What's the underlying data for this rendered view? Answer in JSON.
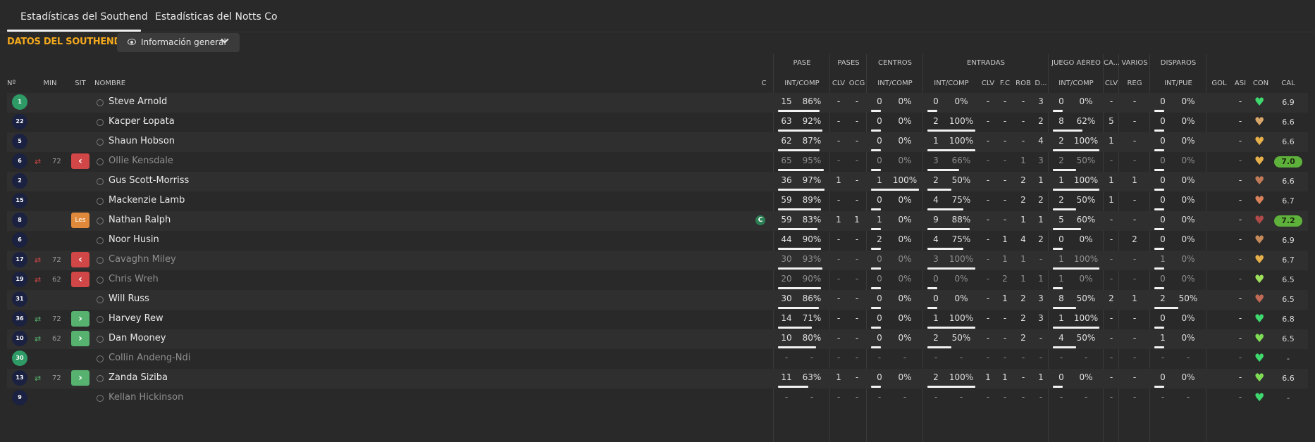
{
  "tabs": [
    "Estadísticas del Southend",
    "Estadísticas del Notts Co"
  ],
  "section_title": "DATOS DEL SOUTHEND",
  "view_select": "Información general",
  "col_headers": {
    "no": "Nº",
    "min": "MIN",
    "sit": "SIT",
    "nombre": "NOMBRE",
    "c": "C",
    "pase_ic": "INT/COMP",
    "clv": "CLV",
    "ocg": "OCG",
    "centros_ic": "INT/COMP",
    "entradas_ic": "INT/COMP",
    "ent_clv": "CLV",
    "fc": "F.C",
    "rob": "ROB",
    "d": "D...",
    "aereo_ic": "INT/COMP",
    "ca_clv": "CLV",
    "reg": "REG",
    "int_pue": "INT/PUE",
    "gol": "GOL",
    "asi": "ASI",
    "con": "CON",
    "cal": "CAL"
  },
  "group_headers": {
    "pase": "PASE",
    "pases": "PASES",
    "centros": "CENTROS",
    "entradas": "ENTRADAS",
    "juego_aereo": "JUEGO AÉREO",
    "ca": "CA...",
    "varios": "VARIOS",
    "disparos": "DISPAROS"
  },
  "colors": {
    "accent": "#f2a81d",
    "sub_off": "#d14646",
    "sub_on": "#56b26e",
    "les": "#e0893a",
    "high_rating": "#5eb13a"
  },
  "rows": [
    {
      "no": "1",
      "gk": true,
      "sub": "",
      "min": "",
      "sit": "",
      "name": "Steve Arnold",
      "dim": false,
      "cap": false,
      "pase": [
        "15",
        "86%"
      ],
      "clv": "-",
      "ocg": "-",
      "cen": [
        "0",
        "0%"
      ],
      "ent": [
        "0",
        "0%"
      ],
      "eclv": "-",
      "fc": "-",
      "rob": "-",
      "d": "3",
      "aer": [
        "0",
        "0%"
      ],
      "caclv": "-",
      "reg": "-",
      "disp": [
        "0",
        "0%"
      ],
      "gol": "",
      "asi": "-",
      "heart": "#3ed86f",
      "cal": "6.9",
      "hi": false,
      "fill": {
        "pase": 0.87,
        "cen": 0,
        "ent": 0,
        "aer": 0,
        "disp": 0
      }
    },
    {
      "no": "22",
      "gk": false,
      "sub": "",
      "min": "",
      "sit": "",
      "name": "Kacper Łopata",
      "dim": false,
      "cap": false,
      "pase": [
        "63",
        "92%"
      ],
      "clv": "-",
      "ocg": "-",
      "cen": [
        "0",
        "0%"
      ],
      "ent": [
        "2",
        "100%"
      ],
      "eclv": "-",
      "fc": "-",
      "rob": "-",
      "d": "2",
      "aer": [
        "8",
        "62%"
      ],
      "caclv": "5",
      "reg": "-",
      "disp": [
        "0",
        "0%"
      ],
      "gol": "",
      "asi": "-",
      "heart": "#d9a66a",
      "cal": "6.6",
      "hi": false,
      "fill": {
        "pase": 0.93,
        "cen": 0,
        "ent": 1,
        "aer": 0.63,
        "disp": 0
      }
    },
    {
      "no": "5",
      "gk": false,
      "sub": "",
      "min": "",
      "sit": "",
      "name": "Shaun Hobson",
      "dim": false,
      "cap": false,
      "pase": [
        "62",
        "87%"
      ],
      "clv": "-",
      "ocg": "-",
      "cen": [
        "0",
        "0%"
      ],
      "ent": [
        "1",
        "100%"
      ],
      "eclv": "-",
      "fc": "-",
      "rob": "-",
      "d": "4",
      "aer": [
        "2",
        "100%"
      ],
      "caclv": "1",
      "reg": "-",
      "disp": [
        "0",
        "0%"
      ],
      "gol": "",
      "asi": "-",
      "heart": "#e8b04a",
      "cal": "6.6",
      "hi": false,
      "fill": {
        "pase": 0.87,
        "cen": 0,
        "ent": 1,
        "aer": 1,
        "disp": 0
      }
    },
    {
      "no": "6",
      "gk": false,
      "sub": "off",
      "min": "72",
      "sit": "off",
      "name": "Ollie Kensdale",
      "dim": true,
      "cap": false,
      "pase": [
        "65",
        "95%"
      ],
      "clv": "-",
      "ocg": "-",
      "cen": [
        "0",
        "0%"
      ],
      "ent": [
        "3",
        "66%"
      ],
      "eclv": "-",
      "fc": "-",
      "rob": "1",
      "d": "3",
      "aer": [
        "2",
        "50%"
      ],
      "caclv": "-",
      "reg": "-",
      "disp": [
        "0",
        "0%"
      ],
      "gol": "",
      "asi": "-",
      "heart": "#e8b04a",
      "cal": "7.0",
      "hi": true,
      "fill": {
        "pase": 0.95,
        "cen": 0,
        "ent": 0.66,
        "aer": 0.5,
        "disp": 0
      }
    },
    {
      "no": "2",
      "gk": false,
      "sub": "",
      "min": "",
      "sit": "",
      "name": "Gus Scott-Morriss",
      "dim": false,
      "cap": false,
      "pase": [
        "36",
        "97%"
      ],
      "clv": "1",
      "ocg": "-",
      "cen": [
        "1",
        "100%"
      ],
      "ent": [
        "2",
        "50%"
      ],
      "eclv": "-",
      "fc": "-",
      "rob": "2",
      "d": "1",
      "aer": [
        "1",
        "100%"
      ],
      "caclv": "1",
      "reg": "1",
      "disp": [
        "0",
        "0%"
      ],
      "gol": "",
      "asi": "-",
      "heart": "#c07a56",
      "cal": "6.6",
      "hi": false,
      "fill": {
        "pase": 0.97,
        "cen": 1,
        "ent": 0.5,
        "aer": 1,
        "disp": 0
      }
    },
    {
      "no": "15",
      "gk": false,
      "sub": "",
      "min": "",
      "sit": "",
      "name": "Mackenzie Lamb",
      "dim": false,
      "cap": false,
      "pase": [
        "59",
        "89%"
      ],
      "clv": "-",
      "ocg": "-",
      "cen": [
        "0",
        "0%"
      ],
      "ent": [
        "4",
        "75%"
      ],
      "eclv": "-",
      "fc": "-",
      "rob": "2",
      "d": "2",
      "aer": [
        "2",
        "50%"
      ],
      "caclv": "1",
      "reg": "-",
      "disp": [
        "0",
        "0%"
      ],
      "gol": "",
      "asi": "-",
      "heart": "#d9825a",
      "cal": "6.7",
      "hi": false,
      "fill": {
        "pase": 0.89,
        "cen": 0,
        "ent": 0.75,
        "aer": 0.5,
        "disp": 0
      }
    },
    {
      "no": "8",
      "gk": false,
      "sub": "",
      "min": "",
      "sit": "les",
      "name": "Nathan Ralph",
      "dim": false,
      "cap": true,
      "pase": [
        "59",
        "83%"
      ],
      "clv": "1",
      "ocg": "1",
      "cen": [
        "1",
        "0%"
      ],
      "ent": [
        "9",
        "88%"
      ],
      "eclv": "-",
      "fc": "-",
      "rob": "1",
      "d": "1",
      "aer": [
        "5",
        "60%"
      ],
      "caclv": "-",
      "reg": "-",
      "disp": [
        "0",
        "0%"
      ],
      "gol": "",
      "asi": "-",
      "heart": "#b24a4a",
      "cal": "7.2",
      "hi": true,
      "fill": {
        "pase": 0.83,
        "cen": 0,
        "ent": 0.88,
        "aer": 0.6,
        "disp": 0
      }
    },
    {
      "no": "6",
      "gk": false,
      "sub": "",
      "min": "",
      "sit": "",
      "name": "Noor Husin",
      "dim": false,
      "cap": false,
      "pase": [
        "44",
        "90%"
      ],
      "clv": "-",
      "ocg": "-",
      "cen": [
        "2",
        "0%"
      ],
      "ent": [
        "4",
        "75%"
      ],
      "eclv": "-",
      "fc": "1",
      "rob": "4",
      "d": "2",
      "aer": [
        "0",
        "0%"
      ],
      "caclv": "-",
      "reg": "2",
      "disp": [
        "0",
        "0%"
      ],
      "gol": "",
      "asi": "-",
      "heart": "#c58a5a",
      "cal": "6.9",
      "hi": false,
      "fill": {
        "pase": 0.9,
        "cen": 0,
        "ent": 0.75,
        "aer": 0,
        "disp": 0
      }
    },
    {
      "no": "17",
      "gk": false,
      "sub": "off",
      "min": "72",
      "sit": "off",
      "name": "Cavaghn Miley",
      "dim": true,
      "cap": false,
      "pase": [
        "30",
        "93%"
      ],
      "clv": "-",
      "ocg": "-",
      "cen": [
        "0",
        "0%"
      ],
      "ent": [
        "3",
        "100%"
      ],
      "eclv": "-",
      "fc": "1",
      "rob": "1",
      "d": "-",
      "aer": [
        "1",
        "100%"
      ],
      "caclv": "-",
      "reg": "-",
      "disp": [
        "1",
        "0%"
      ],
      "gol": "",
      "asi": "-",
      "heart": "#e8b04a",
      "cal": "6.7",
      "hi": false,
      "fill": {
        "pase": 0.93,
        "cen": 0,
        "ent": 1,
        "aer": 1,
        "disp": 0
      }
    },
    {
      "no": "19",
      "gk": false,
      "sub": "off",
      "min": "62",
      "sit": "off",
      "name": "Chris Wreh",
      "dim": true,
      "cap": false,
      "pase": [
        "20",
        "90%"
      ],
      "clv": "-",
      "ocg": "-",
      "cen": [
        "0",
        "0%"
      ],
      "ent": [
        "0",
        "0%"
      ],
      "eclv": "-",
      "fc": "2",
      "rob": "1",
      "d": "1",
      "aer": [
        "1",
        "0%"
      ],
      "caclv": "-",
      "reg": "-",
      "disp": [
        "0",
        "0%"
      ],
      "gol": "",
      "asi": "-",
      "heart": "#9ee05a",
      "cal": "6.5",
      "hi": false,
      "fill": {
        "pase": 0.9,
        "cen": 0,
        "ent": 0,
        "aer": 0,
        "disp": 0
      }
    },
    {
      "no": "31",
      "gk": false,
      "sub": "",
      "min": "",
      "sit": "",
      "name": "Will Russ",
      "dim": false,
      "cap": false,
      "pase": [
        "30",
        "86%"
      ],
      "clv": "-",
      "ocg": "-",
      "cen": [
        "0",
        "0%"
      ],
      "ent": [
        "0",
        "0%"
      ],
      "eclv": "-",
      "fc": "1",
      "rob": "2",
      "d": "3",
      "aer": [
        "8",
        "50%"
      ],
      "caclv": "2",
      "reg": "1",
      "disp": [
        "2",
        "50%"
      ],
      "gol": "",
      "asi": "-",
      "heart": "#c26a55",
      "cal": "6.5",
      "hi": false,
      "fill": {
        "pase": 0.86,
        "cen": 0,
        "ent": 0,
        "aer": 0.5,
        "disp": 0.5
      }
    },
    {
      "no": "36",
      "gk": false,
      "sub": "on",
      "min": "72",
      "sit": "on",
      "name": "Harvey Rew",
      "dim": false,
      "cap": false,
      "pase": [
        "14",
        "71%"
      ],
      "clv": "-",
      "ocg": "-",
      "cen": [
        "0",
        "0%"
      ],
      "ent": [
        "1",
        "100%"
      ],
      "eclv": "-",
      "fc": "-",
      "rob": "2",
      "d": "3",
      "aer": [
        "1",
        "100%"
      ],
      "caclv": "-",
      "reg": "-",
      "disp": [
        "0",
        "0%"
      ],
      "gol": "",
      "asi": "-",
      "heart": "#3ed86f",
      "cal": "6.8",
      "hi": false,
      "fill": {
        "pase": 0.71,
        "cen": 0,
        "ent": 1,
        "aer": 1,
        "disp": 0
      }
    },
    {
      "no": "10",
      "gk": false,
      "sub": "on",
      "min": "62",
      "sit": "on",
      "name": "Dan Mooney",
      "dim": false,
      "cap": false,
      "pase": [
        "10",
        "80%"
      ],
      "clv": "-",
      "ocg": "-",
      "cen": [
        "0",
        "0%"
      ],
      "ent": [
        "2",
        "50%"
      ],
      "eclv": "-",
      "fc": "-",
      "rob": "2",
      "d": "-",
      "aer": [
        "4",
        "50%"
      ],
      "caclv": "-",
      "reg": "-",
      "disp": [
        "1",
        "0%"
      ],
      "gol": "",
      "asi": "-",
      "heart": "#7fdc55",
      "cal": "6.5",
      "hi": false,
      "fill": {
        "pase": 0.8,
        "cen": 0,
        "ent": 0.5,
        "aer": 0.5,
        "disp": 0
      }
    },
    {
      "no": "30",
      "gk": true,
      "sub": "",
      "min": "",
      "sit": "",
      "name": "Collin Andeng-Ndi",
      "dim": true,
      "cap": false,
      "pase": [
        "-",
        "-"
      ],
      "clv": "-",
      "ocg": "-",
      "cen": [
        "-",
        "-"
      ],
      "ent": [
        "-",
        "-"
      ],
      "eclv": "-",
      "fc": "-",
      "rob": "-",
      "d": "-",
      "aer": [
        "-",
        "-"
      ],
      "caclv": "-",
      "reg": "-",
      "disp": [
        "-",
        "-"
      ],
      "gol": "",
      "asi": "-",
      "heart": "#3ed86f",
      "cal": "-",
      "hi": false,
      "fill": null
    },
    {
      "no": "13",
      "gk": false,
      "sub": "on",
      "min": "72",
      "sit": "on",
      "name": "Zanda Siziba",
      "dim": false,
      "cap": false,
      "pase": [
        "11",
        "63%"
      ],
      "clv": "1",
      "ocg": "-",
      "cen": [
        "0",
        "0%"
      ],
      "ent": [
        "2",
        "100%"
      ],
      "eclv": "1",
      "fc": "1",
      "rob": "-",
      "d": "1",
      "aer": [
        "0",
        "0%"
      ],
      "caclv": "-",
      "reg": "-",
      "disp": [
        "0",
        "0%"
      ],
      "gol": "",
      "asi": "-",
      "heart": "#7fdc55",
      "cal": "6.6",
      "hi": false,
      "fill": {
        "pase": 0.63,
        "cen": 0,
        "ent": 1,
        "aer": 0,
        "disp": 0
      }
    },
    {
      "no": "9",
      "gk": false,
      "sub": "",
      "min": "",
      "sit": "",
      "name": "Kellan Hickinson",
      "dim": true,
      "cap": false,
      "pase": [
        "-",
        "-"
      ],
      "clv": "-",
      "ocg": "-",
      "cen": [
        "-",
        "-"
      ],
      "ent": [
        "-",
        "-"
      ],
      "eclv": "-",
      "fc": "-",
      "rob": "-",
      "d": "-",
      "aer": [
        "-",
        "-"
      ],
      "caclv": "-",
      "reg": "-",
      "disp": [
        "-",
        "-"
      ],
      "gol": "",
      "asi": "-",
      "heart": "#3ed86f",
      "cal": "-",
      "hi": false,
      "fill": null
    }
  ]
}
